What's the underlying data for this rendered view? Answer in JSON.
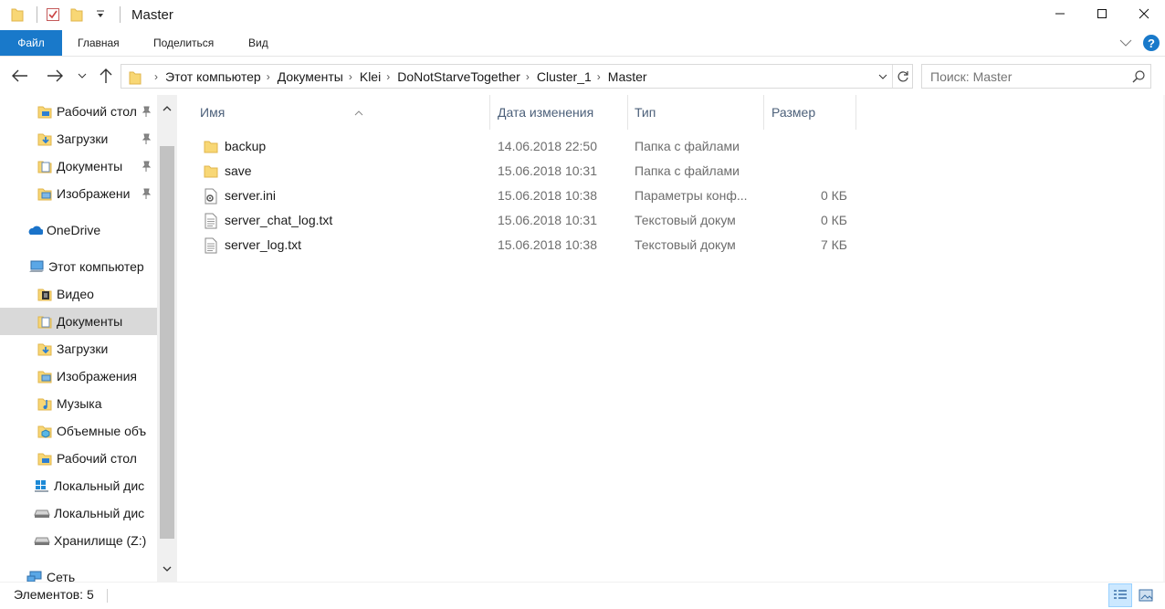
{
  "window": {
    "title": "Master"
  },
  "ribbon": {
    "tabs": [
      {
        "label": "Файл"
      },
      {
        "label": "Главная"
      },
      {
        "label": "Поделиться"
      },
      {
        "label": "Вид"
      }
    ]
  },
  "address": {
    "crumbs": [
      "Этот компьютер",
      "Документы",
      "Klei",
      "DoNotStarveTogether",
      "Cluster_1",
      "Master"
    ]
  },
  "search": {
    "placeholder": "Поиск: Master"
  },
  "nav": {
    "items": [
      {
        "label": "Рабочий стол",
        "icon": "desktop-folder-icon",
        "pinned": true
      },
      {
        "label": "Загрузки",
        "icon": "downloads-folder-icon",
        "pinned": true
      },
      {
        "label": "Документы",
        "icon": "documents-folder-icon",
        "pinned": true
      },
      {
        "label": "Изображени",
        "icon": "pictures-folder-icon",
        "pinned": true
      },
      {
        "label": "OneDrive",
        "icon": "onedrive-icon"
      },
      {
        "label": "Этот компьютер",
        "icon": "this-pc-icon"
      },
      {
        "label": "Видео",
        "icon": "videos-folder-icon"
      },
      {
        "label": "Документы",
        "icon": "documents-folder-icon",
        "selected": true
      },
      {
        "label": "Загрузки",
        "icon": "downloads-folder-icon"
      },
      {
        "label": "Изображения",
        "icon": "pictures-folder-icon"
      },
      {
        "label": "Музыка",
        "icon": "music-folder-icon"
      },
      {
        "label": "Объемные объ",
        "icon": "3d-objects-folder-icon"
      },
      {
        "label": "Рабочий стол",
        "icon": "desktop-folder-icon"
      },
      {
        "label": "Локальный дис",
        "icon": "windows-drive-icon"
      },
      {
        "label": "Локальный дис",
        "icon": "drive-icon"
      },
      {
        "label": "Хранилище (Z:)",
        "icon": "network-drive-icon"
      },
      {
        "label": "Сеть",
        "icon": "network-icon"
      }
    ]
  },
  "columns": {
    "name": "Имя",
    "date": "Дата изменения",
    "type": "Тип",
    "size": "Размер"
  },
  "files": [
    {
      "name": "backup",
      "date": "14.06.2018 22:50",
      "type": "Папка с файлами",
      "size": "",
      "icon": "folder-icon"
    },
    {
      "name": "save",
      "date": "15.06.2018 10:31",
      "type": "Папка с файлами",
      "size": "",
      "icon": "folder-icon"
    },
    {
      "name": "server.ini",
      "date": "15.06.2018 10:38",
      "type": "Параметры конф...",
      "size": "0 КБ",
      "icon": "settings-file-icon"
    },
    {
      "name": "server_chat_log.txt",
      "date": "15.06.2018 10:31",
      "type": "Текстовый докум",
      "size": "0 КБ",
      "icon": "text-file-icon"
    },
    {
      "name": "server_log.txt",
      "date": "15.06.2018 10:38",
      "type": "Текстовый докум",
      "size": "7 КБ",
      "icon": "text-file-icon"
    }
  ],
  "status": {
    "count": "Элементов: 5"
  },
  "colors": {
    "accent": "#1979ca",
    "folder": "#f8d775",
    "selected_nav": "#d9d9d9"
  }
}
